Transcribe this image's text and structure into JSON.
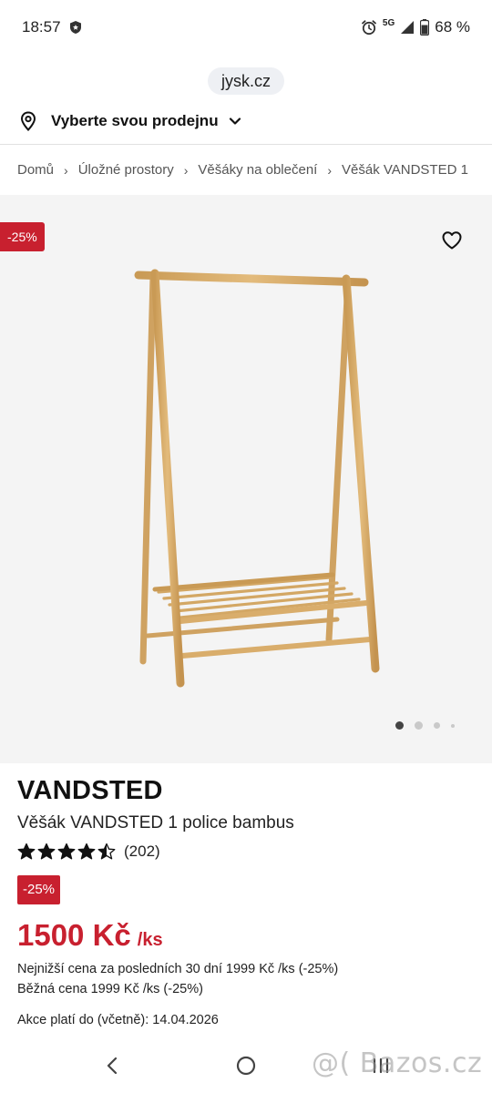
{
  "status_bar": {
    "time": "18:57",
    "network": "5G",
    "battery": "68 %",
    "icons": [
      "shield-icon",
      "alarm-icon",
      "signal-icon",
      "battery-icon"
    ]
  },
  "browser": {
    "url": "jysk.cz"
  },
  "store_selector": {
    "label": "Vyberte svou prodejnu",
    "icons": [
      "location-pin-icon",
      "chevron-down-icon"
    ]
  },
  "breadcrumb": {
    "items": [
      "Domů",
      "Úložné prostory",
      "Věšáky na oblečení",
      "Věšák VANDSTED 1"
    ],
    "separator": "›"
  },
  "gallery": {
    "discount_badge": "-25%",
    "wishlist_icon": "heart-icon",
    "image": "bamboo-clothes-rack",
    "current_slide": 1,
    "slide_count": 4
  },
  "product": {
    "name": "VANDSTED",
    "subtitle": "Věšák VANDSTED 1 police bambus",
    "rating": 4.5,
    "rating_max": 5,
    "review_count": "(202)",
    "discount_badge": "-25%",
    "price": "1500 Kč",
    "price_unit": "/ks",
    "lowest_price_note": "Nejnižší cena za posledních 30 dní 1999 Kč /ks (-25%)",
    "regular_price_note": "Běžná cena 1999 Kč /ks (-25%)",
    "offer_valid": "Akce platí do (včetně): 14.04.2026"
  },
  "nav_bar": {
    "icons": [
      "back-icon",
      "home-icon",
      "recent-apps-icon"
    ],
    "watermark": "@( Bazos.cz"
  },
  "colors": {
    "accent_red": "#c8202f",
    "gallery_bg": "#f4f4f4",
    "url_pill_bg": "#eef0f4",
    "bamboo": "#d9ad6b"
  }
}
